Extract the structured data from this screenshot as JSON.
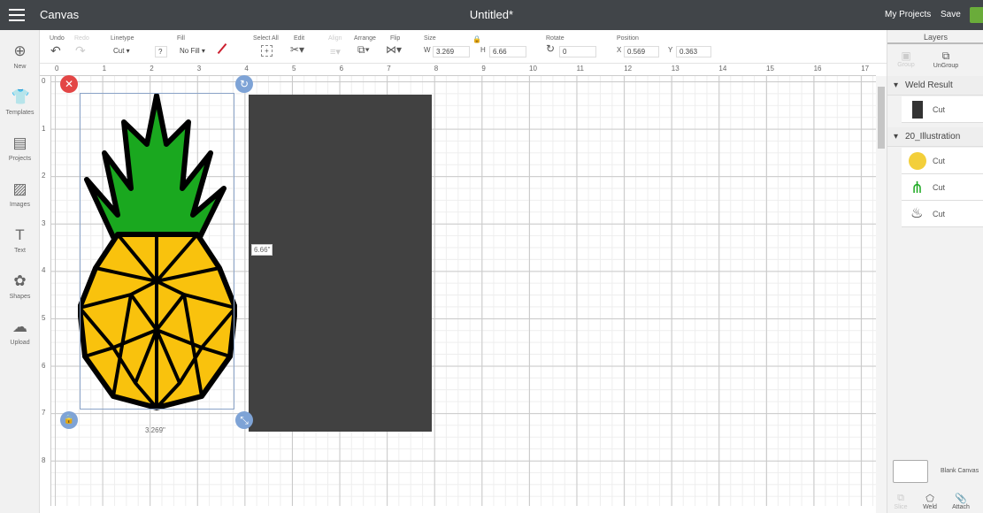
{
  "header": {
    "app": "Canvas",
    "title": "Untitled*",
    "my_projects": "My Projects",
    "save": "Save"
  },
  "sidebar": [
    {
      "label": "New",
      "icon": "plus-icon"
    },
    {
      "label": "Templates",
      "icon": "shirt-icon"
    },
    {
      "label": "Projects",
      "icon": "projects-icon"
    },
    {
      "label": "Images",
      "icon": "image-icon"
    },
    {
      "label": "Text",
      "icon": "text-icon"
    },
    {
      "label": "Shapes",
      "icon": "shapes-icon"
    },
    {
      "label": "Upload",
      "icon": "upload-icon"
    }
  ],
  "toolbar": {
    "undo": "Undo",
    "redo": "Redo",
    "linetype": "Linetype",
    "linetype_value": "Cut",
    "help": "?",
    "fill": "Fill",
    "fill_value": "No Fill",
    "select_all": "Select All",
    "edit": "Edit",
    "align": "Align",
    "arrange": "Arrange",
    "flip": "Flip",
    "size": "Size",
    "w_label": "W",
    "w": "3.269",
    "h_label": "H",
    "h": "6.66",
    "rotate": "Rotate",
    "rotate_value": "0",
    "position": "Position",
    "x_label": "X",
    "x": "0.569",
    "y_label": "Y",
    "y": "0.363",
    "line_color": "#cc1f2f"
  },
  "ruler": {
    "h": [
      "0",
      "1",
      "2",
      "3",
      "4",
      "5",
      "6",
      "7",
      "8",
      "9",
      "10",
      "11",
      "12",
      "13",
      "14",
      "15",
      "16",
      "17"
    ],
    "v": [
      "0",
      "1",
      "2",
      "3",
      "4",
      "5",
      "6",
      "7",
      "8"
    ]
  },
  "canvas": {
    "height_label": "6.66\"",
    "width_label": "3.269\"",
    "rect_color": "#414141"
  },
  "layers": {
    "title": "Layers",
    "group_btn": "Group",
    "ungroup_btn": "UnGroup",
    "groups": [
      {
        "name": "Weld Result",
        "items": [
          {
            "label": "Cut",
            "thumb": "dark-rectangle"
          }
        ]
      },
      {
        "name": "20_Illustration",
        "items": [
          {
            "label": "Cut",
            "thumb": "yellow-shape"
          },
          {
            "label": "Cut",
            "thumb": "green-leaves"
          },
          {
            "label": "Cut",
            "thumb": "pineapple-outline"
          }
        ]
      }
    ],
    "blank_canvas": "Blank Canvas",
    "slice": "Slice",
    "weld": "Weld",
    "attach": "Attach"
  }
}
